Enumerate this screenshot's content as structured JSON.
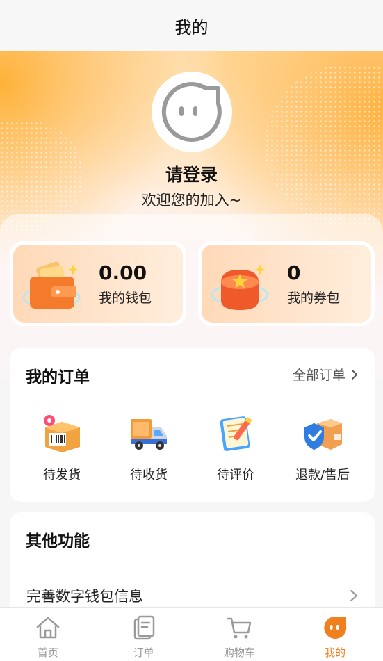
{
  "header": {
    "title": "我的"
  },
  "profile": {
    "login_text": "请登录",
    "welcome_text": "欢迎您的加入~"
  },
  "wallet": {
    "value": "0.00",
    "label": "我的钱包"
  },
  "coupon": {
    "value": "0",
    "label": "我的券包"
  },
  "orders": {
    "title": "我的订单",
    "all_label": "全部订单",
    "items": [
      {
        "label": "待发货",
        "icon": "package-barcode-icon"
      },
      {
        "label": "待收货",
        "icon": "delivery-truck-icon"
      },
      {
        "label": "待评价",
        "icon": "notebook-pencil-icon"
      },
      {
        "label": "退款/售后",
        "icon": "shield-box-icon"
      }
    ]
  },
  "functions": {
    "title": "其他功能",
    "items": [
      {
        "label": "完善数字钱包信息"
      }
    ]
  },
  "tabbar": {
    "items": [
      {
        "label": "首页",
        "icon": "home-icon"
      },
      {
        "label": "订单",
        "icon": "order-icon"
      },
      {
        "label": "购物车",
        "icon": "cart-icon"
      },
      {
        "label": "我的",
        "icon": "profile-face-icon",
        "active": true
      }
    ]
  },
  "colors": {
    "accent": "#f0801f",
    "hero": "#ffb347"
  }
}
